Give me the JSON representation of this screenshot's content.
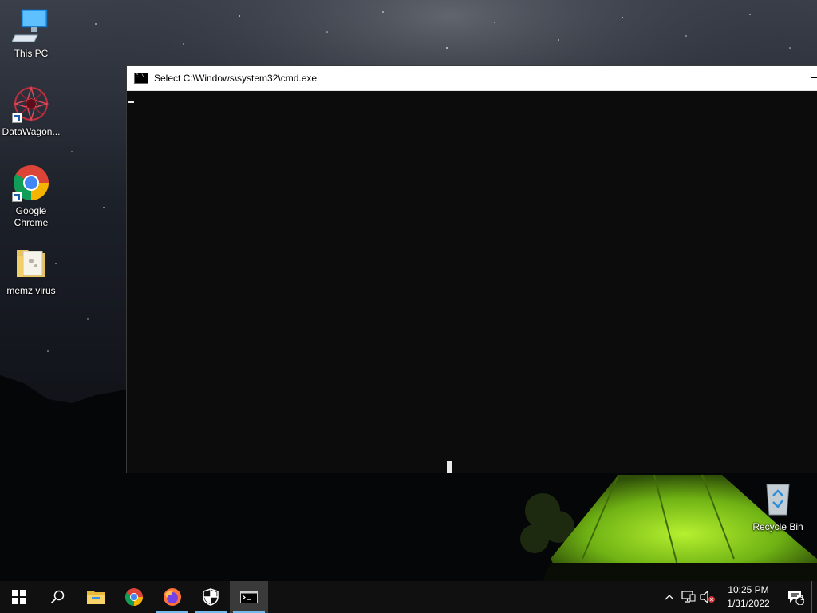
{
  "desktop": {
    "icons": [
      {
        "label": "This PC"
      },
      {
        "label": "DataWagon..."
      },
      {
        "label": "Google Chrome"
      },
      {
        "label": "memz virus"
      },
      {
        "label": "Recycle Bin"
      }
    ]
  },
  "cmd_window": {
    "title": "Select C:\\Windows\\system32\\cmd.exe"
  },
  "taskbar": {
    "buttons": [
      {
        "icon": "windows-start-icon"
      },
      {
        "icon": "search-icon"
      },
      {
        "icon": "file-explorer-icon"
      },
      {
        "icon": "chrome-icon"
      },
      {
        "icon": "firefox-icon"
      },
      {
        "icon": "security-shield-icon"
      },
      {
        "icon": "cmd-icon"
      }
    ],
    "tray": {
      "time": "10:25 PM",
      "date": "1/31/2022",
      "notification_count": "1"
    }
  },
  "colors": {
    "accent": "#76b9ed",
    "taskbar": "#101010",
    "console_bg": "#0c0c0c"
  }
}
